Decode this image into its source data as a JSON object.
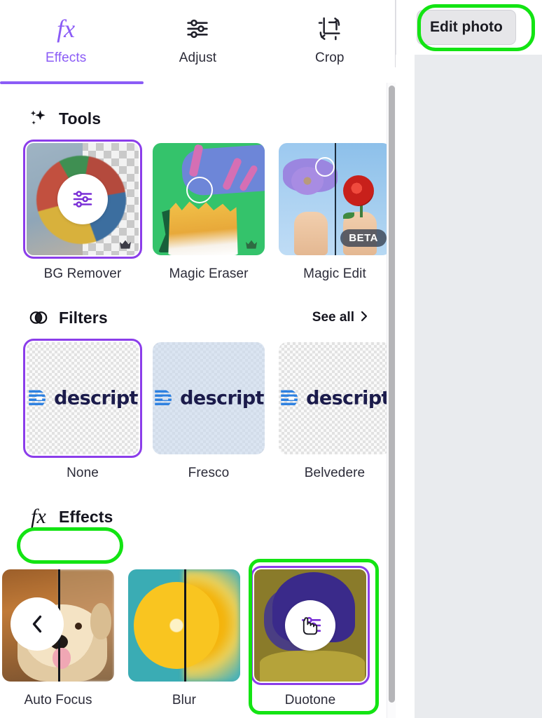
{
  "app": {
    "panel_name": "photo-editor-panel"
  },
  "tabs": [
    {
      "id": "effects",
      "label": "Effects",
      "icon": "fx-icon",
      "active": true
    },
    {
      "id": "adjust",
      "label": "Adjust",
      "icon": "sliders-icon",
      "active": false
    },
    {
      "id": "crop",
      "label": "Crop",
      "icon": "crop-rotate-icon",
      "active": false
    }
  ],
  "sections": {
    "tools": {
      "title": "Tools",
      "icon": "sparkles-icon",
      "cards": [
        {
          "label": "BG Remover",
          "selected": true,
          "badge": "crown"
        },
        {
          "label": "Magic Eraser",
          "selected": false,
          "badge": "crown"
        },
        {
          "label": "Magic Edit",
          "selected": false,
          "badge": "BETA"
        }
      ]
    },
    "filters": {
      "title": "Filters",
      "icon": "overlapping-circles-icon",
      "see_all_label": "See all",
      "see_all_chevron": "chevron-right-icon",
      "logo_text": "descript",
      "cards": [
        {
          "label": "None",
          "selected": true
        },
        {
          "label": "Fresco",
          "selected": false
        },
        {
          "label": "Belvedere",
          "selected": false
        }
      ]
    },
    "effects": {
      "title": "Effects",
      "icon": "fx-icon",
      "cards": [
        {
          "label": "Auto Focus",
          "selected": false
        },
        {
          "label": "Blur",
          "selected": false
        },
        {
          "label": "Duotone",
          "selected": true
        }
      ]
    }
  },
  "right": {
    "edit_photo_label": "Edit photo"
  },
  "colors": {
    "accent_purple": "#8b5cf6",
    "selection_purple": "#8b3dea",
    "annotation_green": "#13e413",
    "canvas_gray": "#e9ebee",
    "text_dark": "#15151f"
  },
  "annotations": [
    {
      "target": "edit-photo-button",
      "shape": "pill"
    },
    {
      "target": "effects-section-header",
      "shape": "pill"
    },
    {
      "target": "duotone-card",
      "shape": "rect"
    }
  ]
}
